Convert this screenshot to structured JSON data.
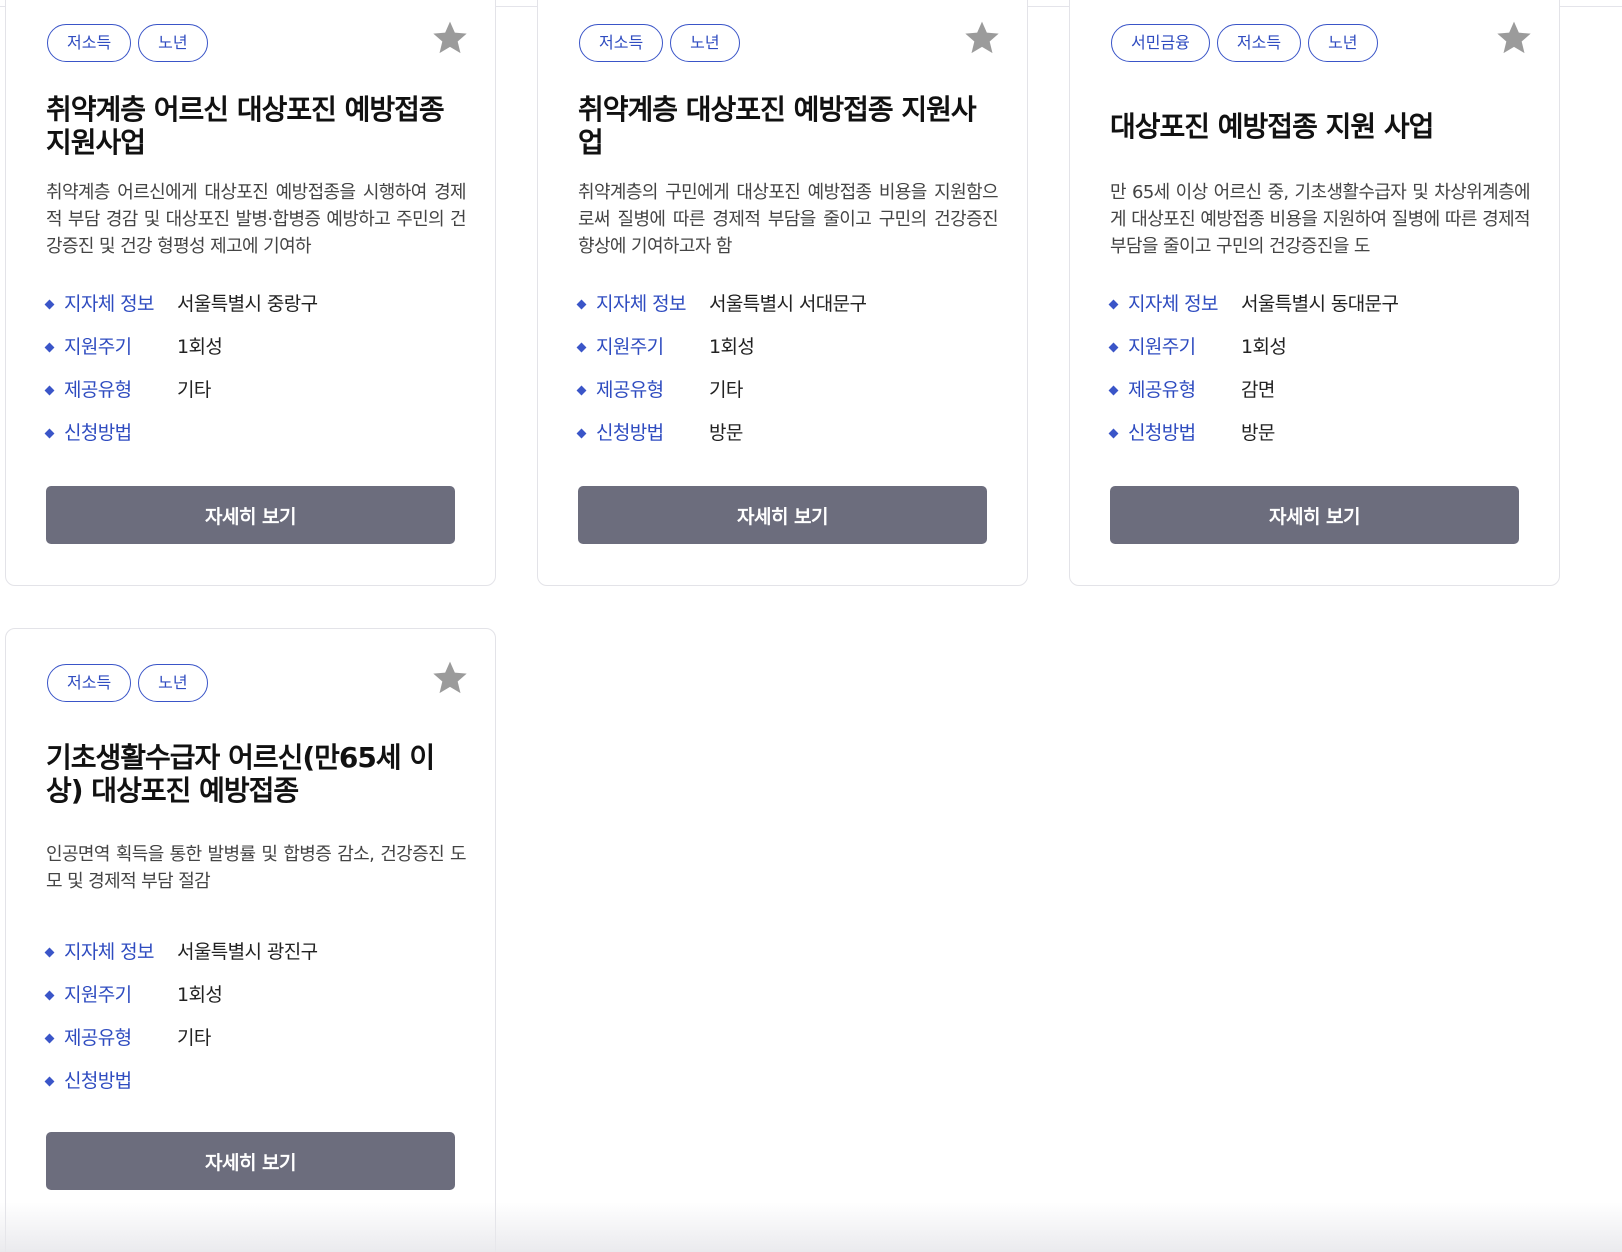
{
  "labels": {
    "region": "지자체 정보",
    "cycle": "지원주기",
    "type": "제공유형",
    "method": "신청방법",
    "detail_button": "자세히 보기"
  },
  "icons": {
    "favorite": "star-icon",
    "bullet": "diamond-bullet-icon"
  },
  "colors": {
    "accent": "#2f4cc0",
    "button": "#6c6d7d",
    "star": "#9b9b9b"
  },
  "cards": [
    {
      "tags": [
        "저소득",
        "노년"
      ],
      "title": "취약계층 어르신 대상포진 예방접종 지원사업",
      "desc": "취약계층 어르신에게 대상포진 예방접종을 시행하여 경제적 부담 경감 및 대상포진 발병·합병증 예방하고 주민의 건강증진 및 건강 형평성 제고에 기여하",
      "region": "서울특별시 중랑구",
      "cycle": "1회성",
      "type": "기타",
      "method": ""
    },
    {
      "tags": [
        "저소득",
        "노년"
      ],
      "title": "취약계층 대상포진 예방접종 지원사업",
      "desc": "취약계층의 구민에게 대상포진 예방접종 비용을 지원함으로써 질병에 따른 경제적 부담을 줄이고 구민의 건강증진 향상에 기여하고자 함",
      "region": "서울특별시 서대문구",
      "cycle": "1회성",
      "type": "기타",
      "method": "방문"
    },
    {
      "tags": [
        "서민금융",
        "저소득",
        "노년"
      ],
      "title": "대상포진 예방접종 지원 사업",
      "desc": "만 65세 이상 어르신 중, 기초생활수급자 및 차상위계층에게 대상포진 예방접종 비용을 지원하여 질병에 따른 경제적 부담을 줄이고 구민의 건강증진을 도",
      "region": "서울특별시 동대문구",
      "cycle": "1회성",
      "type": "감면",
      "method": "방문"
    },
    {
      "tags": [
        "저소득",
        "노년"
      ],
      "title": "기초생활수급자  어르신(만65세  이상) 대상포진 예방접종",
      "desc": "인공면역 획득을 통한 발병률 및 합병증 감소, 건강증진 도모 및 경제적 부담 절감",
      "region": "서울특별시 광진구",
      "cycle": "1회성",
      "type": "기타",
      "method": ""
    }
  ]
}
